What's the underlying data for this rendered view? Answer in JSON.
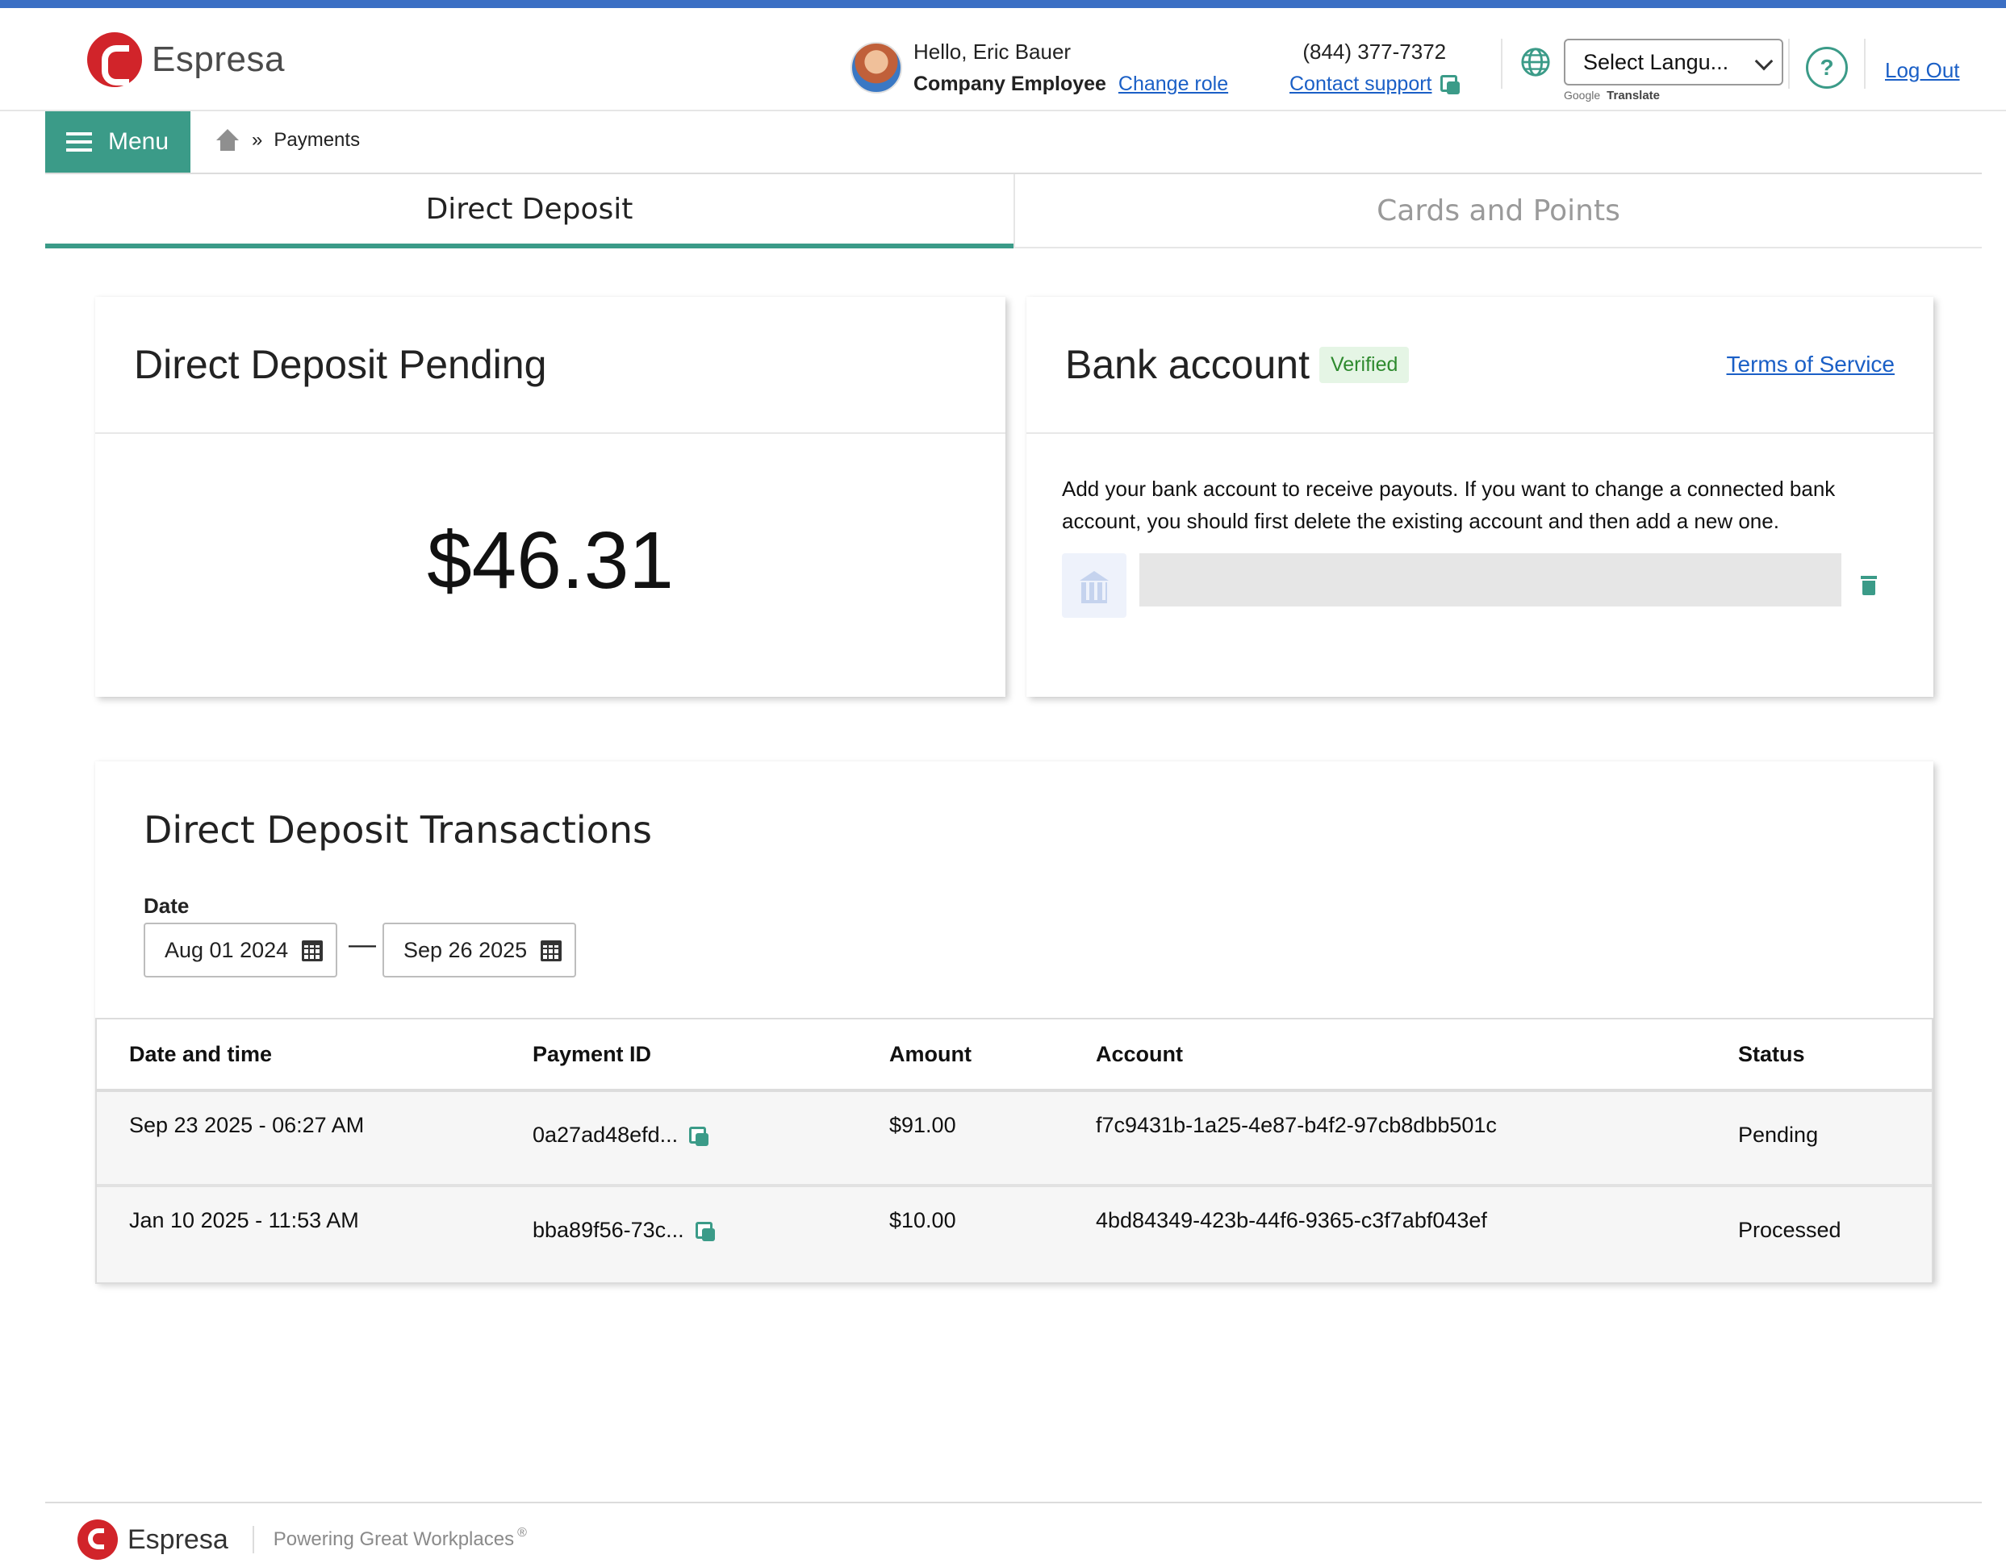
{
  "brand": {
    "name": "Espresa",
    "tagline": "Powering Great Workplaces",
    "tagline_mark": "®"
  },
  "colors": {
    "accent": "#3b9b88",
    "top_stripe": "#3b6fc4",
    "link": "#1a5fc6",
    "logo_red": "#d1242a"
  },
  "header": {
    "greeting": "Hello, Eric Bauer",
    "role": "Company Employee",
    "change_role": "Change role",
    "phone": "(844) 377-7372",
    "contact_support": "Contact support",
    "language_select": "Select Langu...",
    "google_label": "Google",
    "translate_label": "Translate",
    "help_symbol": "?",
    "logout": "Log Out"
  },
  "nav": {
    "menu_label": "Menu",
    "breadcrumb_separator": "»",
    "breadcrumb_current": "Payments"
  },
  "tabs": [
    {
      "label": "Direct Deposit",
      "active": true
    },
    {
      "label": "Cards and Points",
      "active": false
    }
  ],
  "pending": {
    "title": "Direct Deposit Pending",
    "amount": "$46.31"
  },
  "bank": {
    "title": "Bank account",
    "badge": "Verified",
    "terms_link": "Terms of Service",
    "description": "Add your bank account to receive payouts. If you want to change a connected bank account, you should first delete the existing account and then add a new one."
  },
  "transactions": {
    "title": "Direct Deposit Transactions",
    "date_label": "Date",
    "date_from": "Aug 01 2024",
    "date_separator": "—",
    "date_to": "Sep 26 2025",
    "columns": [
      "Date and time",
      "Payment ID",
      "Amount",
      "Account",
      "Status"
    ],
    "rows": [
      {
        "datetime": "Sep 23 2025 - 06:27 AM",
        "payment_id": "0a27ad48efd...",
        "amount": "$91.00",
        "account": "f7c9431b-1a25-4e87-b4f2-97cb8dbb501c",
        "status": "Pending"
      },
      {
        "datetime": "Jan 10 2025 - 11:53 AM",
        "payment_id": "bba89f56-73c...",
        "amount": "$10.00",
        "account": "4bd84349-423b-44f6-9365-c3f7abf043ef",
        "status": "Processed"
      }
    ]
  },
  "icons": [
    "espresa-logo-icon",
    "avatar",
    "copy-icon",
    "globe-icon",
    "help-icon",
    "hamburger-icon",
    "home-icon",
    "bank-icon",
    "trash-icon",
    "calendar-icon"
  ]
}
